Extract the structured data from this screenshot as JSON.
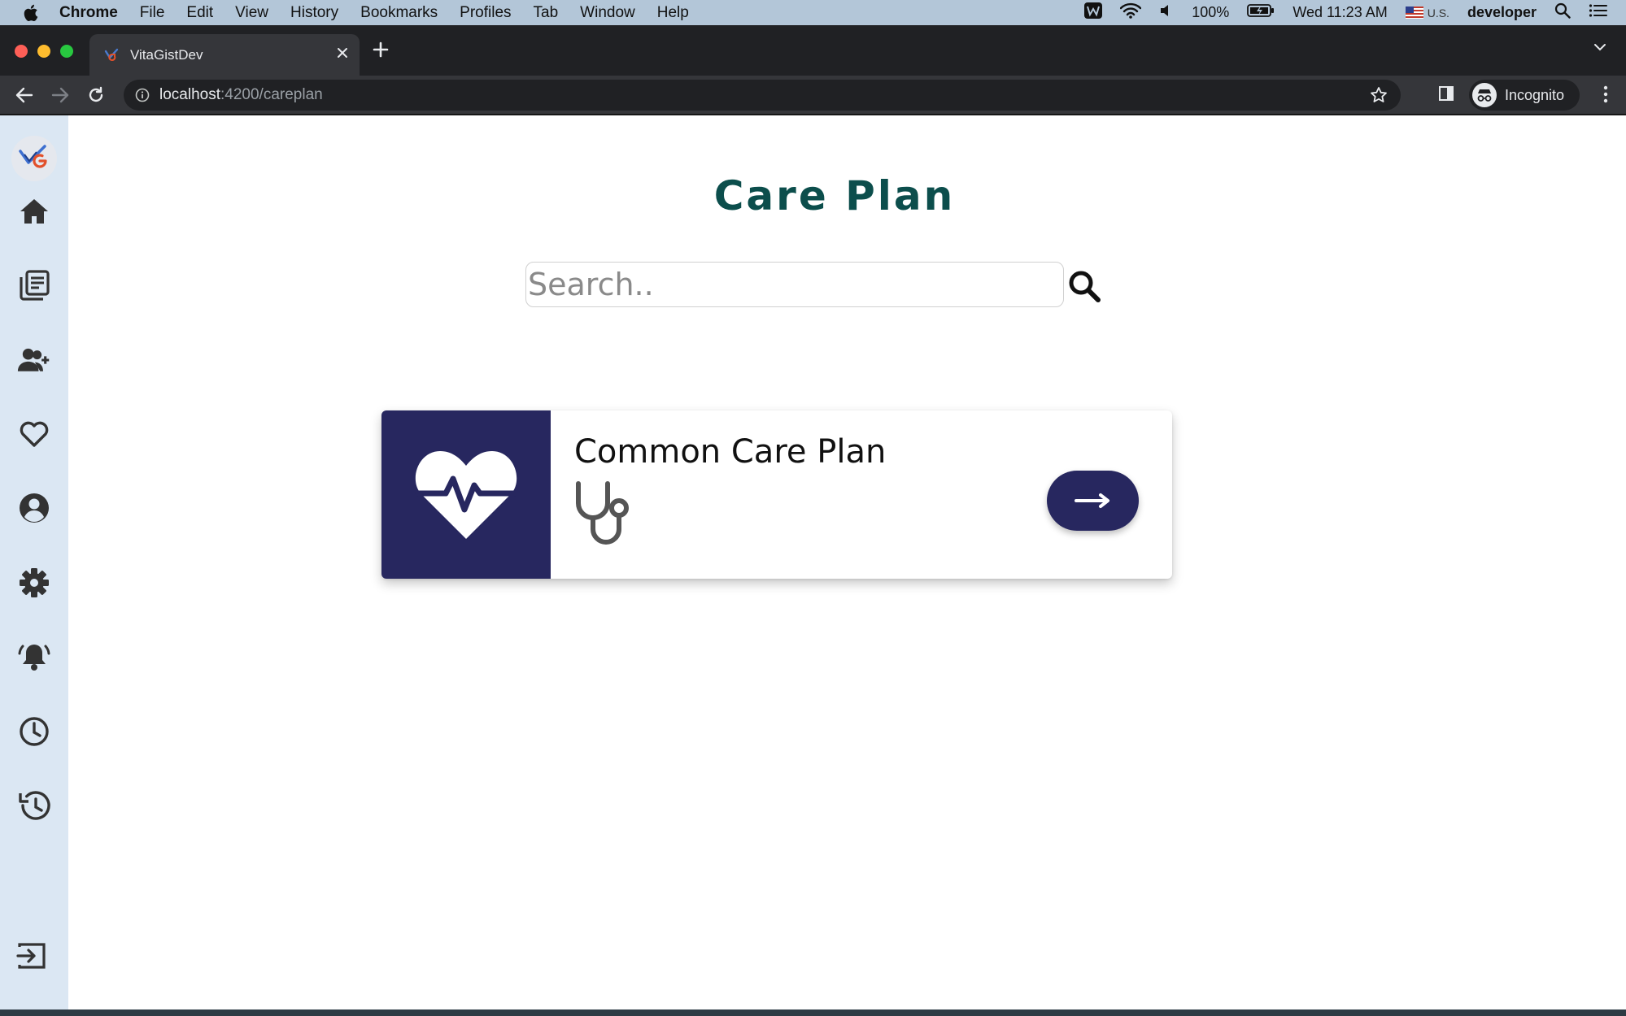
{
  "menubar": {
    "app_name": "Chrome",
    "items": [
      "File",
      "Edit",
      "View",
      "History",
      "Bookmarks",
      "Profiles",
      "Tab",
      "Window",
      "Help"
    ],
    "battery": "100%",
    "clock": "Wed 11:23 AM",
    "input_source": "U.S.",
    "user": "developer"
  },
  "browser": {
    "tab_title": "VitaGistDev",
    "url_host": "localhost",
    "url_path": ":4200/careplan",
    "profile_label": "Incognito"
  },
  "page": {
    "title": "Care Plan",
    "search_placeholder": "Search..",
    "cards": [
      {
        "title": "Common Care Plan"
      }
    ]
  },
  "colors": {
    "sidebar_bg": "#dbe7f3",
    "title_color": "#0c4e4c",
    "card_accent": "#27275f"
  },
  "icons": {
    "sidebar": [
      "home-icon",
      "library-icon",
      "add-user-icon",
      "heart-icon",
      "account-icon",
      "settings-icon",
      "alarm-bell-icon",
      "clock-icon",
      "history-icon",
      "logout-icon"
    ],
    "card_media": "heartbeat-icon",
    "card_secondary": "stethoscope-icon",
    "card_action": "arrow-right-icon"
  }
}
